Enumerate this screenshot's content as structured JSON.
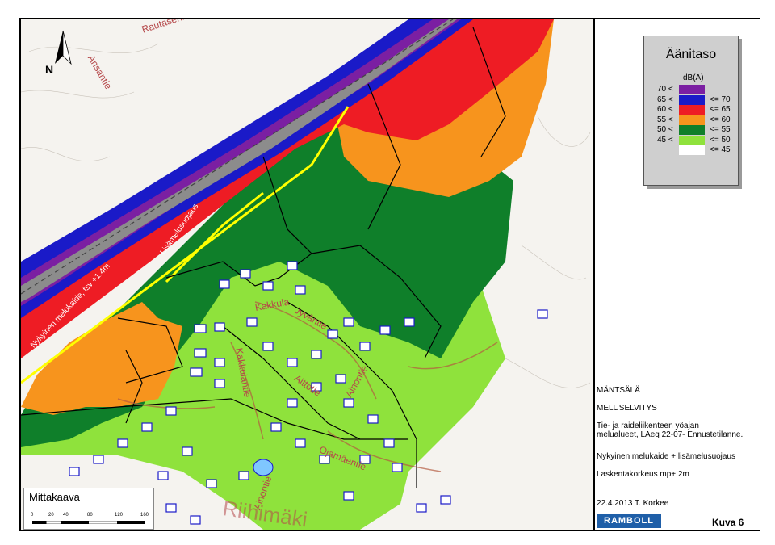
{
  "legend": {
    "title": "Äänitaso",
    "unit": "dB(A)",
    "rows": [
      {
        "lo": "70 <",
        "hi": "",
        "color": "#7b1fa2"
      },
      {
        "lo": "65 <",
        "hi": "<= 70",
        "color": "#1a1ac8"
      },
      {
        "lo": "60 <",
        "hi": "<= 65",
        "color": "#ee1c24"
      },
      {
        "lo": "55 <",
        "hi": "<= 60",
        "color": "#f7941d"
      },
      {
        "lo": "50 <",
        "hi": "<= 55",
        "color": "#0f7f2a"
      },
      {
        "lo": "45 <",
        "hi": "<= 50",
        "color": "#8fe23c"
      },
      {
        "lo": "",
        "hi": "<= 45",
        "color": "#ffffff"
      }
    ]
  },
  "info": {
    "place": "MÄNTSÄLÄ",
    "report": "MELUSELVITYS",
    "desc1": "Tie- ja raideliikenteen yöajan",
    "desc2": "melualueet, LAeq 22-07- Ennustetilanne.",
    "desc3": "Nykyinen melukaide + lisämelusuojaus",
    "desc4": "Laskentakorkeus mp+ 2m",
    "date": "22.4.2013 T. Korkee",
    "logo": "RAMBOLL",
    "figure": "Kuva 6"
  },
  "scale": {
    "title": "Mittakaava",
    "ticks": [
      "0",
      "20",
      "40",
      "80",
      "120",
      "160"
    ]
  },
  "map_labels": {
    "north": "N",
    "rautasenkatu": "Rautasenkatu",
    "ansantie": "Ansantie",
    "melukaide": "Nykyinen melukaide, tsv +1.4m",
    "lisamelusuojaus": "Lisämelusuojaus",
    "kakkula": "Kakkula",
    "jyvantie": "Jyväntie",
    "kakkulantie": "Kakkulantie",
    "aittotie": "Aittotie",
    "ainontie": "Ainontie",
    "ojamaentie": "Ojamäentie",
    "riihimaki": "Riihimäki",
    "ainontie2": "Ainontie"
  },
  "colors": {
    "purple": "#7b1fa2",
    "blue": "#1a1ac8",
    "red": "#ee1c24",
    "orange": "#f7941d",
    "dark_green": "#0f7f2a",
    "light_green": "#8fe23c",
    "railway": "#8c8c8c",
    "barrier": "#ffff00"
  }
}
